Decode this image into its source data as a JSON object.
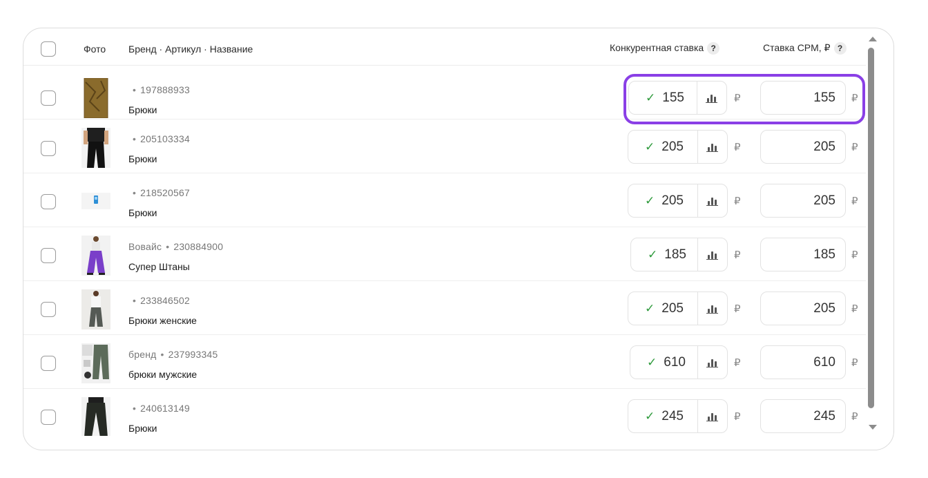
{
  "header": {
    "photo": "Фото",
    "brand_article_name": "Бренд · Артикул · Название",
    "competitive_bid": "Конкурентная ставка",
    "cpm_bid": "Ставка CPM, ₽",
    "help": "?"
  },
  "currency": "₽",
  "rows": [
    {
      "brand": "",
      "article": "197888933",
      "name": "Брюки",
      "competitive_bid": "155",
      "cpm": "155"
    },
    {
      "brand": "",
      "article": "205103334",
      "name": "Брюки",
      "competitive_bid": "205",
      "cpm": "205"
    },
    {
      "brand": "",
      "article": "218520567",
      "name": "Брюки",
      "competitive_bid": "205",
      "cpm": "205"
    },
    {
      "brand": "Вовайс",
      "article": "230884900",
      "name": "Супер Штаны",
      "competitive_bid": "185",
      "cpm": "185"
    },
    {
      "brand": "",
      "article": "233846502",
      "name": "Брюки женские",
      "competitive_bid": "205",
      "cpm": "205"
    },
    {
      "brand": "бренд",
      "article": "237993345",
      "name": "брюки мужские",
      "competitive_bid": "610",
      "cpm": "610"
    },
    {
      "brand": "",
      "article": "240613149",
      "name": "Брюки",
      "competitive_bid": "245",
      "cpm": "245"
    }
  ],
  "colors": {
    "highlight": "#8a3fe6",
    "check": "#2e9a3c"
  }
}
